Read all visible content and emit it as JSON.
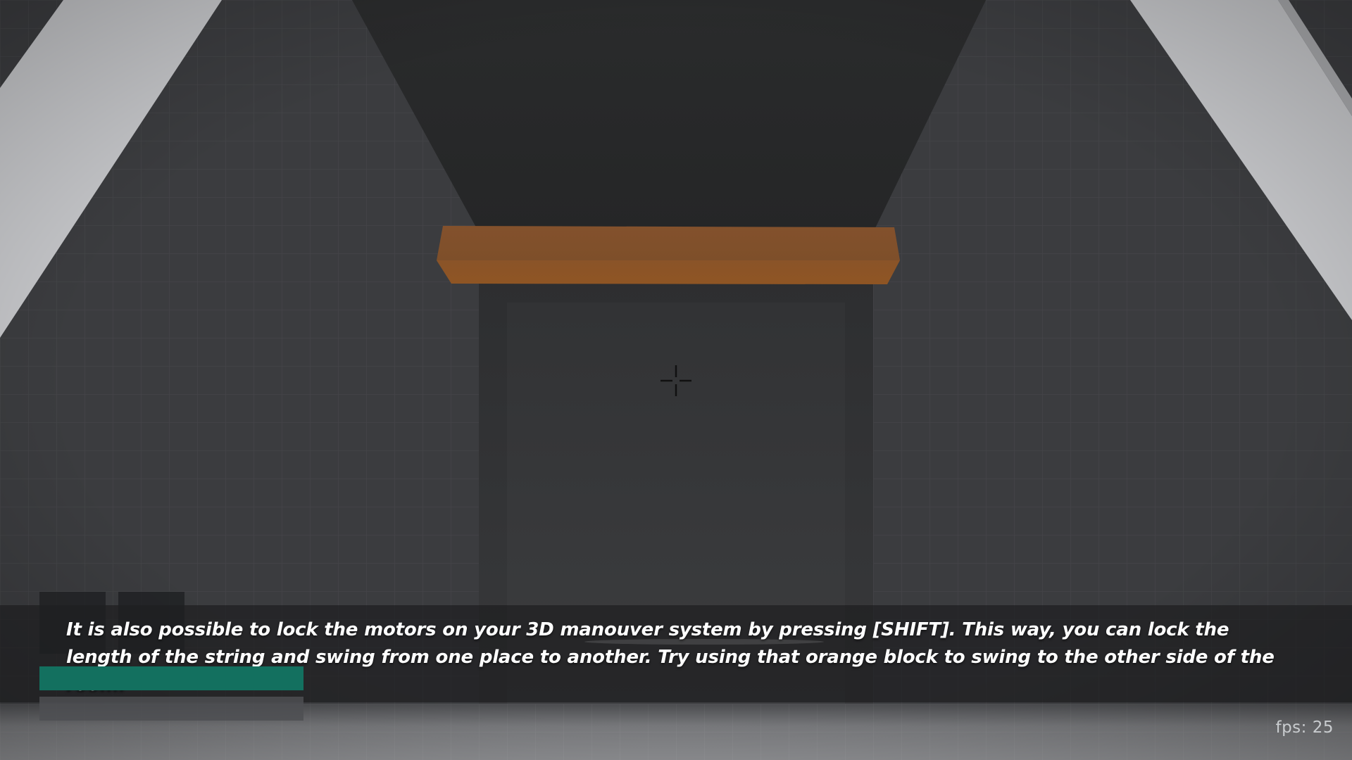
{
  "hud": {
    "subtitle": "It is also possible to lock the motors on your 3D manouver system by pressing [SHIFT]. This way, you can lock the length of the string and swing from one place to another. Try using that orange block to swing to the other side of the room.",
    "fps_label": "fps: ",
    "fps_value": "25",
    "gas_level": 1.0,
    "gas_color": "#13705f",
    "health_level": 1.0
  },
  "scene": {
    "target_block_color": "#8a5328",
    "wall_color": "#3a3b3e",
    "light_panel_color": "#c4c5c8"
  },
  "colors": {
    "subtitle_text": "#ffffff",
    "subtitle_background": "#1a1a1c",
    "fps_text": "#c9cccf"
  }
}
